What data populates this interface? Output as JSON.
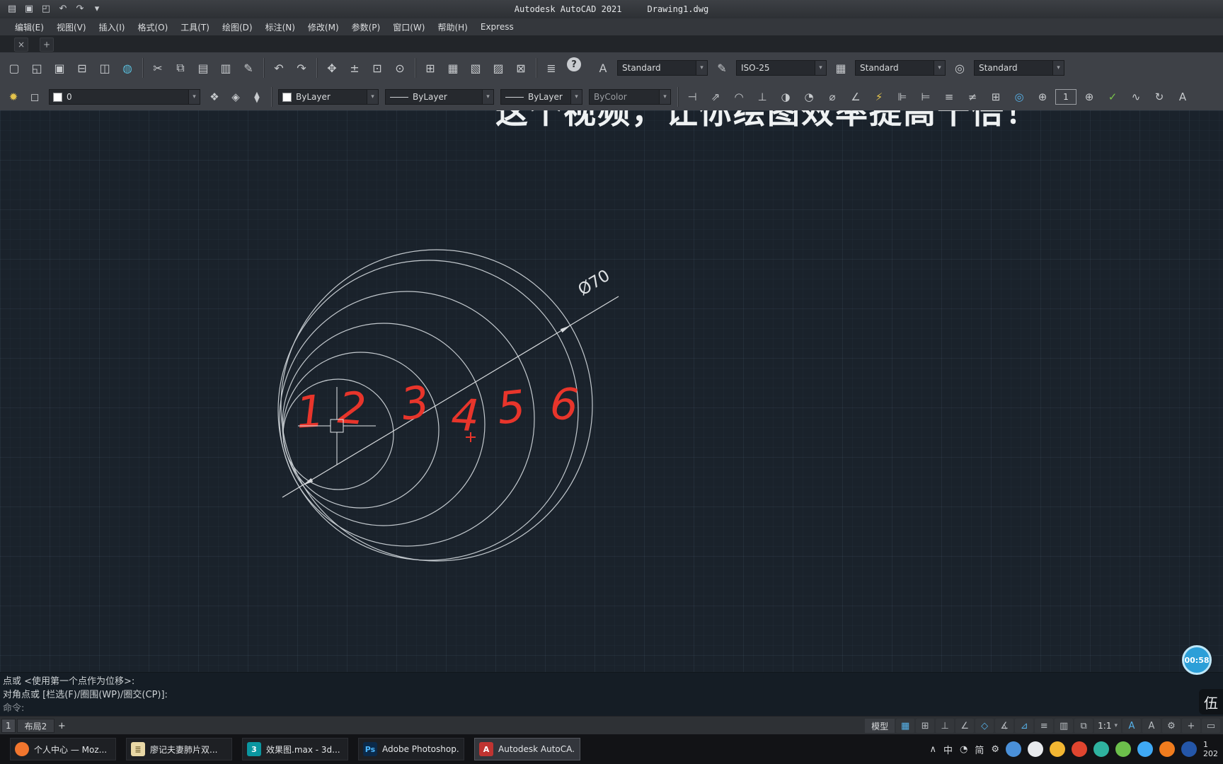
{
  "colors": {
    "accent_blue": "#56b2ea",
    "annotation_red": "#e8352b",
    "canvas_bg": "#1a222b",
    "toolbar_bg": "#3e4147",
    "timer_blue": "#2c9fd8",
    "drawing_line": "#c3c9ce"
  },
  "window": {
    "title_app": "Autodesk AutoCAD 2021",
    "title_doc": "Drawing1.dwg"
  },
  "qat": {
    "icons": [
      {
        "name": "app-menu-icon",
        "glyph": "▤"
      },
      {
        "name": "qat-save-icon",
        "glyph": "▣"
      },
      {
        "name": "qat-open-icon",
        "glyph": "◰"
      },
      {
        "name": "qat-undo-icon",
        "glyph": "↶"
      },
      {
        "name": "qat-redo-icon",
        "glyph": "↷"
      },
      {
        "name": "qat-menu-icon",
        "glyph": "▾"
      }
    ]
  },
  "menu": {
    "items": [
      {
        "name": "menu-edit",
        "label": "编辑(E)"
      },
      {
        "name": "menu-view",
        "label": "视图(V)"
      },
      {
        "name": "menu-insert",
        "label": "插入(I)"
      },
      {
        "name": "menu-format",
        "label": "格式(O)"
      },
      {
        "name": "menu-tools",
        "label": "工具(T)"
      },
      {
        "name": "menu-draw",
        "label": "绘图(D)"
      },
      {
        "name": "menu-dimension",
        "label": "标注(N)"
      },
      {
        "name": "menu-modify",
        "label": "修改(M)"
      },
      {
        "name": "menu-parametric",
        "label": "参数(P)"
      },
      {
        "name": "menu-window",
        "label": "窗口(W)"
      },
      {
        "name": "menu-help",
        "label": "帮助(H)"
      },
      {
        "name": "menu-express",
        "label": "Express"
      }
    ]
  },
  "file_tabs": {
    "close": "×",
    "add": "+"
  },
  "toolbar_standard": {
    "groups": {
      "file": [
        {
          "name": "new-icon",
          "glyph": "▢"
        },
        {
          "name": "open-icon",
          "glyph": "◱"
        },
        {
          "name": "save-icon",
          "glyph": "▣"
        },
        {
          "name": "plot-icon",
          "glyph": "⊟"
        },
        {
          "name": "plot-preview-icon",
          "glyph": "◫"
        },
        {
          "name": "publish-icon",
          "glyph": "◍",
          "tone": "teal"
        }
      ],
      "clipboard": [
        {
          "name": "cut-icon",
          "glyph": "✂"
        },
        {
          "name": "copy-icon",
          "glyph": "⧉"
        },
        {
          "name": "paste-icon",
          "glyph": "▤"
        },
        {
          "name": "paste-special-icon",
          "glyph": "▥"
        },
        {
          "name": "match-properties-icon",
          "glyph": "✎"
        }
      ],
      "undo": [
        {
          "name": "undo-icon",
          "glyph": "↶"
        },
        {
          "name": "redo-icon",
          "glyph": "↷"
        }
      ],
      "view": [
        {
          "name": "pan-icon",
          "glyph": "✥"
        },
        {
          "name": "zoom-realtime-icon",
          "glyph": "±"
        },
        {
          "name": "zoom-window-icon",
          "glyph": "⊡"
        },
        {
          "name": "zoom-previous-icon",
          "glyph": "⊙"
        }
      ],
      "panels": [
        {
          "name": "viewports-icon",
          "glyph": "⊞"
        },
        {
          "name": "named-views-icon",
          "glyph": "▦"
        },
        {
          "name": "sheet-set-icon",
          "glyph": "▧"
        },
        {
          "name": "markup-icon",
          "glyph": "▨"
        },
        {
          "name": "quick-calc-icon",
          "glyph": "⊠"
        }
      ],
      "misc": [
        {
          "name": "properties-icon",
          "glyph": "≣"
        },
        {
          "name": "help-icon",
          "glyph": "?"
        }
      ]
    },
    "style_group": [
      {
        "icon_name": "text-style-icon",
        "icon_glyph": "A",
        "select_name": "text-style-select",
        "value": "Standard"
      },
      {
        "icon_name": "dim-style-icon",
        "icon_glyph": "✎",
        "select_name": "dim-style-select",
        "value": "ISO-25"
      },
      {
        "icon_name": "table-style-icon",
        "icon_glyph": "▦",
        "select_name": "table-style-select",
        "value": "Standard"
      },
      {
        "icon_name": "mleader-style-icon",
        "icon_glyph": "◎",
        "select_name": "mleader-style-select",
        "value": "Standard"
      }
    ]
  },
  "properties_bar": {
    "left_icons": [
      {
        "name": "layer-bulb-icon",
        "glyph": "✹",
        "tone": "yellow"
      },
      {
        "name": "layer-lock-icon",
        "glyph": "◻"
      }
    ],
    "layer_value": "0",
    "layer_tools": [
      {
        "name": "layer-properties-icon",
        "glyph": "❖"
      },
      {
        "name": "make-layer-current-icon",
        "glyph": "◈"
      },
      {
        "name": "layer-previous-icon",
        "glyph": "⧫"
      }
    ],
    "color_value": "ByLayer",
    "linetype_value": "ByLayer",
    "lineweight_value": "ByLayer",
    "plotstyle_value": "ByColor",
    "dim_icons_a": [
      {
        "name": "dim-linear-icon",
        "glyph": "⊣"
      },
      {
        "name": "dim-aligned-icon",
        "glyph": "⇗"
      },
      {
        "name": "dim-arc-length-icon",
        "glyph": "◠"
      },
      {
        "name": "dim-ordinate-icon",
        "glyph": "⊥"
      },
      {
        "name": "dim-radius-icon",
        "glyph": "◑"
      },
      {
        "name": "dim-jogged-icon",
        "glyph": "◔"
      },
      {
        "name": "dim-diameter-icon",
        "glyph": "⌀"
      },
      {
        "name": "dim-angular-icon",
        "glyph": "∠"
      },
      {
        "name": "quick-dim-icon",
        "glyph": "⚡",
        "tone": "yellow"
      },
      {
        "name": "dim-baseline-icon",
        "glyph": "⊫"
      },
      {
        "name": "dim-continue-icon",
        "glyph": "⊨"
      },
      {
        "name": "dim-space-icon",
        "glyph": "≡"
      },
      {
        "name": "dim-break-icon",
        "glyph": "≠"
      },
      {
        "name": "tolerance-icon",
        "glyph": "⊞"
      },
      {
        "name": "center-mark-icon",
        "glyph": "◎",
        "tone": "blue"
      },
      {
        "name": "dim-inspect-icon",
        "glyph": "⊕"
      }
    ],
    "counter_value": "1",
    "dim_icons_b": [
      {
        "name": "dim-plus-icon",
        "glyph": "⊕"
      },
      {
        "name": "dim-check-icon",
        "glyph": "✓",
        "tone": "green"
      },
      {
        "name": "dim-jogline-icon",
        "glyph": "∿"
      },
      {
        "name": "dim-update-icon",
        "glyph": "↻"
      },
      {
        "name": "dim-text-icon",
        "glyph": "A"
      }
    ]
  },
  "canvas": {
    "header_text": "这个视频，让你绘图效率提高十倍！",
    "dimension_label": "Ø70",
    "red_numbers": [
      "1",
      "2",
      "3",
      "4",
      "5",
      "6"
    ]
  },
  "command_line": {
    "lines": [
      "点或 <使用第一个点作为位移>:",
      "对角点或 [栏选(F)/圈围(WP)/圈交(CP)]:"
    ],
    "prompt": "命令:"
  },
  "layout_bar": {
    "tabs": [
      "1",
      "布局2"
    ],
    "add": "+"
  },
  "status_bar": {
    "model_label": "模型",
    "scale": "1:1",
    "icons_a": [
      {
        "name": "grid-icon",
        "glyph": "▦",
        "tone": "blue"
      },
      {
        "name": "snap-icon",
        "glyph": "⊞"
      },
      {
        "name": "ortho-icon",
        "glyph": "⊥"
      },
      {
        "name": "polar-icon",
        "glyph": "∠"
      },
      {
        "name": "osnap-icon",
        "glyph": "◇",
        "tone": "blue"
      },
      {
        "name": "otrack-icon",
        "glyph": "∡"
      },
      {
        "name": "dynamic-input-icon",
        "glyph": "⊿",
        "tone": "blue"
      },
      {
        "name": "lineweight-icon",
        "glyph": "≡"
      },
      {
        "name": "transparency-icon",
        "glyph": "▥"
      },
      {
        "name": "selection-cycling-icon",
        "glyph": "⧉"
      }
    ],
    "icons_b": [
      {
        "name": "annotation-visibility-icon",
        "glyph": "A",
        "tone": "blue"
      },
      {
        "name": "autoscale-icon",
        "glyph": "A"
      },
      {
        "name": "workspace-gear-icon",
        "glyph": "⚙"
      },
      {
        "name": "annotation-monitor-icon",
        "glyph": "+"
      },
      {
        "name": "clean-screen-icon",
        "glyph": "▭"
      }
    ]
  },
  "taskbar": {
    "items": [
      {
        "name": "taskbar-firefox",
        "icon_name": "firefox-icon",
        "label": "个人中心 — Moz...",
        "icon_text": "",
        "icon_bg": "#f2762e",
        "icon_kind": "circle",
        "active": "false"
      },
      {
        "name": "taskbar-doc",
        "icon_name": "document-icon",
        "label": "廖记夫妻肺片双...",
        "icon_text": "≣",
        "icon_fg": "#7a6a3a",
        "icon_bg": "#e9d8a6",
        "icon_kind": "square",
        "active": "false"
      },
      {
        "name": "taskbar-3dsmax",
        "icon_name": "3dsmax-icon",
        "label": "效果图.max - 3d...",
        "icon_text": "3",
        "icon_bg": "#0a96a0",
        "icon_kind": "square",
        "active": "false"
      },
      {
        "name": "taskbar-photoshop",
        "icon_name": "photoshop-icon",
        "label": "Adobe Photoshop...",
        "icon_text": "Ps",
        "icon_fg": "#4db8ff",
        "icon_bg": "#0b2a4a",
        "icon_kind": "square",
        "active": "false"
      },
      {
        "name": "taskbar-autocad",
        "icon_name": "autocad-icon",
        "label": "Autodesk AutoCA...",
        "icon_text": "A",
        "icon_bg": "#c03431",
        "icon_kind": "square",
        "active": "true"
      }
    ],
    "tray_small": [
      {
        "name": "tray-expand-icon",
        "glyph": "∧"
      },
      {
        "name": "ime-lang-icon",
        "glyph": "中"
      },
      {
        "name": "tray-clock-icon",
        "glyph": "◔"
      },
      {
        "name": "ime-mode-icon",
        "glyph": "简"
      },
      {
        "name": "tray-settings-icon",
        "glyph": "⚙"
      }
    ],
    "tray_circles": [
      {
        "name": "tray-app-1",
        "color": "#4a90d9"
      },
      {
        "name": "tray-app-2",
        "color": "#e8eaed"
      },
      {
        "name": "tray-app-3",
        "color": "#f2b632"
      },
      {
        "name": "tray-app-4",
        "color": "#e0452f"
      },
      {
        "name": "tray-app-5",
        "color": "#2fb3a0"
      },
      {
        "name": "tray-app-6",
        "color": "#6cbf4b"
      },
      {
        "name": "tray-app-7",
        "color": "#3fa9f5"
      },
      {
        "name": "tray-app-8",
        "color": "#f07c1e"
      },
      {
        "name": "tray-app-9",
        "color": "#2456a8"
      }
    ],
    "clock_line1": "1",
    "clock_line2": "202"
  },
  "overlay": {
    "timer": "00:58",
    "watermark": "伍"
  }
}
